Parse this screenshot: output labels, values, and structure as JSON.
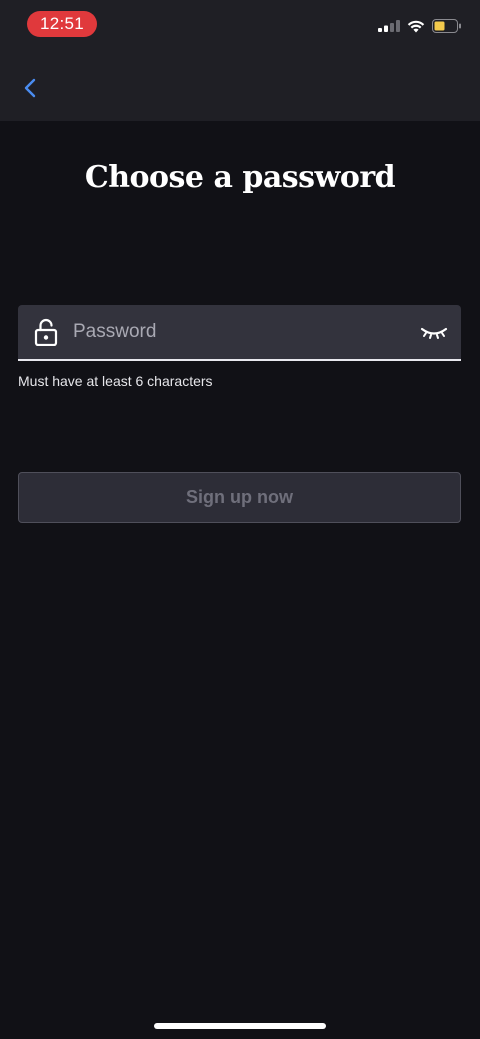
{
  "status_bar": {
    "time": "12:51",
    "icons": [
      "cellular-signal-icon",
      "wifi-icon",
      "battery-icon"
    ],
    "time_pill_color": "#e0393c",
    "battery_color": "#f2c94c"
  },
  "header": {
    "back_icon": "chevron-left-icon",
    "accent_color": "#4a8cf0"
  },
  "page": {
    "title": "Choose a password"
  },
  "password_field": {
    "placeholder": "Password",
    "value": "",
    "left_icon": "lock-icon",
    "right_icon": "eye-closed-icon",
    "hint": "Must have at least 6 characters"
  },
  "actions": {
    "signup_label": "Sign up now"
  }
}
